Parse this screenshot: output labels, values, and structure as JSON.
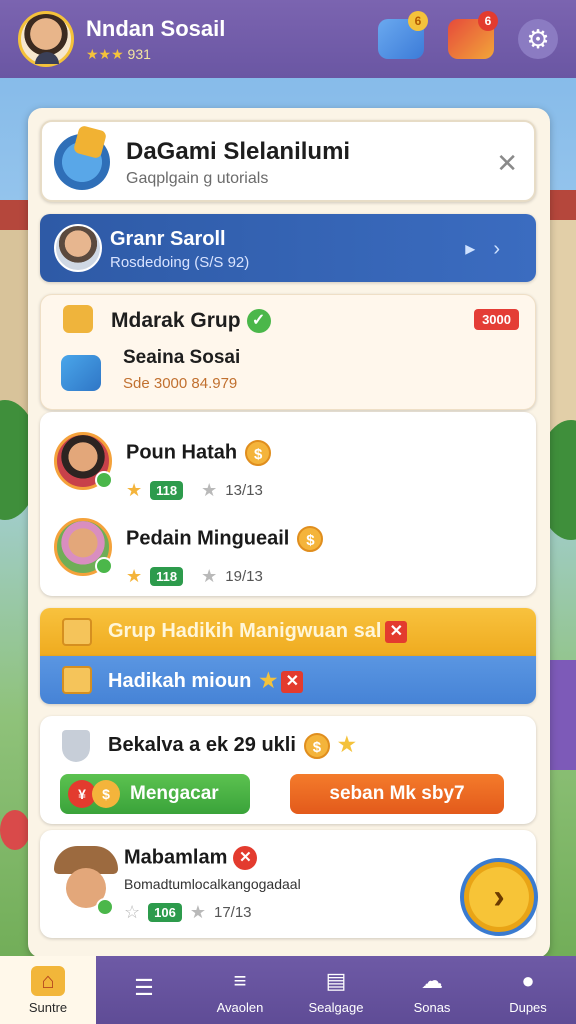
{
  "user": {
    "name": "Nndan Sosail",
    "stars": "★★★",
    "rating": "931"
  },
  "topbar": {
    "messages_badge": "6",
    "gifts_badge": "6",
    "settings_icon": "gear-icon"
  },
  "header": {
    "title": "DaGami Slelanilumi",
    "subtitle": "Gaqplgain g utorials"
  },
  "friend": {
    "name": "Granr Saroll",
    "status": "Rosdedoing (S/S 92)"
  },
  "group": {
    "title": "Mdarak Grup",
    "tag": "3000",
    "sub_name": "Seaina Sosai",
    "sub_detail": "Sde 3000 84.979"
  },
  "members": [
    {
      "name": "Poun Hatah",
      "coin": "$",
      "level": "118",
      "score": "13/13"
    },
    {
      "name": "Pedain Mingueail",
      "coin": "$",
      "level": "118",
      "score": "19/13"
    }
  ],
  "banners": {
    "yellow": "Grup  Hadikih Manigwuan sal",
    "blue": "Hadikah mioun"
  },
  "reward": {
    "title": "Bekalva a ek 29 ukli",
    "btn_green": "Mengacar",
    "btn_orange": "seban Mk sby7"
  },
  "profile": {
    "name": "Mabamlam",
    "desc": "Bomadtumlocalkangogadaal",
    "level": "106",
    "score": "17/13"
  },
  "nav": [
    {
      "label": "Suntre",
      "icon": "home-icon"
    },
    {
      "label": "",
      "icon": "notes-icon"
    },
    {
      "label": "Avaolen",
      "icon": "list-icon"
    },
    {
      "label": "Sealgage",
      "icon": "money-icon"
    },
    {
      "label": "Sonas",
      "icon": "cloud-icon"
    },
    {
      "label": "Dupes",
      "icon": "profile-icon"
    }
  ],
  "colors": {
    "topbar": "#6a56a3",
    "accent_yellow": "#f4b43b",
    "accent_blue": "#3b6cc0",
    "success_green": "#4bb74a",
    "danger_red": "#e33b2e"
  }
}
